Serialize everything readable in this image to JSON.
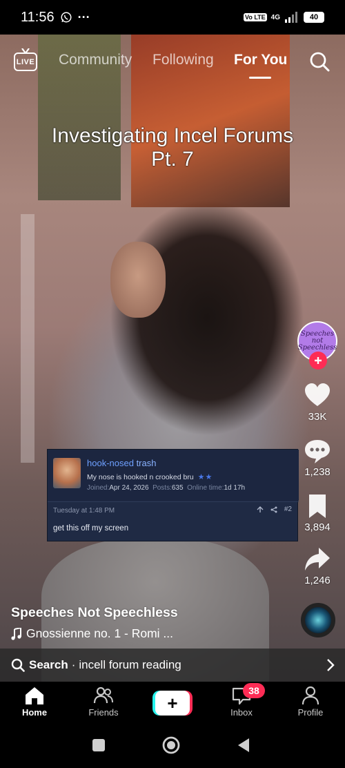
{
  "status_bar": {
    "time": "11:56",
    "notification_dots": "···",
    "volte_label": "Vo LTE",
    "network_label": "4G",
    "battery_level": "40"
  },
  "top_nav": {
    "live_label": "LIVE",
    "tabs": [
      {
        "label": "Community",
        "active": false
      },
      {
        "label": "Following",
        "active": false
      },
      {
        "label": "For You",
        "active": true
      }
    ]
  },
  "video": {
    "title_line1": "Investigating Incel Forums",
    "title_line2": "Pt. 7"
  },
  "forum_post": {
    "username_part1": "hook-nosed ",
    "username_part2": "trash",
    "signature": "My nose is hooked n crooked bru",
    "stars": "★★",
    "joined_label": "Joined:",
    "joined_value": "Apr 24, 2026",
    "posts_label": "Posts:",
    "posts_value": "635",
    "online_label": "Online time:",
    "online_value": "1d 17h",
    "timestamp": "Tuesday at 1:48 PM",
    "post_number": "#2",
    "body": "get this off my screen"
  },
  "rail": {
    "creator_avatar_text": "Speeches not Speechless",
    "likes": "33K",
    "comments": "1,238",
    "saves": "3,894",
    "shares": "1,246"
  },
  "caption": {
    "author": "Speeches Not Speechless",
    "music": "Gnossienne no. 1 - Romi ..."
  },
  "search_bar": {
    "label": "Search",
    "separator": "·",
    "query": "incell forum reading"
  },
  "bottom_nav": {
    "items": [
      {
        "label": "Home",
        "active": true
      },
      {
        "label": "Friends",
        "active": false
      },
      {
        "label": "Inbox",
        "active": false
      },
      {
        "label": "Profile",
        "active": false
      }
    ],
    "create_label": "+",
    "inbox_badge": "38"
  },
  "colors": {
    "accent_red": "#fe2c55",
    "accent_cyan": "#25f4ee",
    "forum_bg": "#1f2a44",
    "forum_link": "#6ea0ff"
  }
}
